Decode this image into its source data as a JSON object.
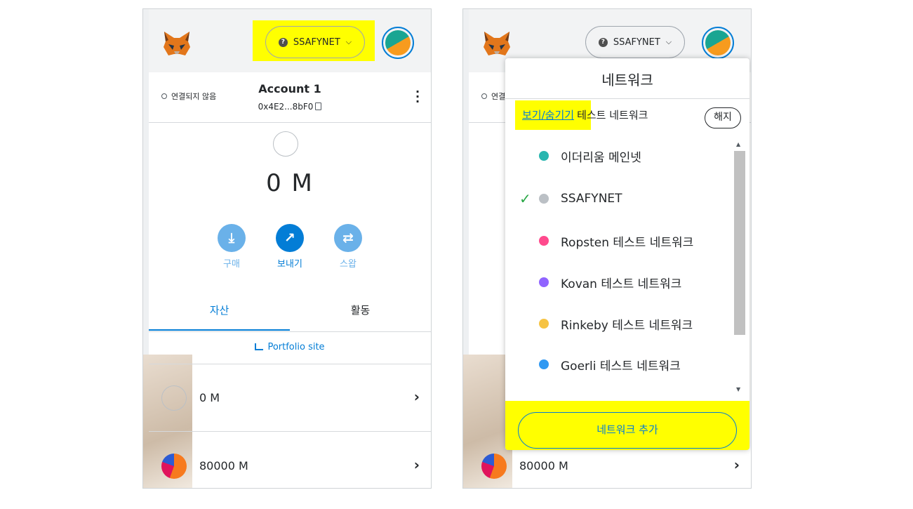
{
  "left": {
    "network_label": "SSAFYNET",
    "connection_status": "연결되지 않음",
    "account_name": "Account 1",
    "account_address": "0x4E2...8bF0",
    "balance": "0 M",
    "actions": [
      {
        "label": "구매",
        "icon": "download-icon",
        "color": "#6ab1e9"
      },
      {
        "label": "보내기",
        "icon": "arrow-up-right-icon",
        "color": "#037dd6"
      },
      {
        "label": "스왑",
        "icon": "swap-icon",
        "color": "#6ab1e9"
      }
    ],
    "tabs": [
      {
        "label": "자산",
        "active": true
      },
      {
        "label": "활동",
        "active": false
      }
    ],
    "portfolio_link": "Portfolio site",
    "assets": [
      {
        "value": "0 M",
        "icon": "empty-token-icon"
      },
      {
        "value": "80000 M",
        "icon": "pie-token-icon"
      }
    ]
  },
  "right": {
    "network_label": "SSAFYNET",
    "connection_status": "연결",
    "dropdown": {
      "title": "네트워크",
      "show_hide_link": "보기/숨기기",
      "show_hide_suffix": "테스트 네트워크",
      "hide_button": "해지",
      "networks": [
        {
          "name": "이더리움 메인넷",
          "color": "#29b6af",
          "selected": false
        },
        {
          "name": "SSAFYNET",
          "color": "#bbc0c5",
          "selected": true
        },
        {
          "name": "Ropsten 테스트 네트워크",
          "color": "#ff4a8d",
          "selected": false
        },
        {
          "name": "Kovan 테스트 네트워크",
          "color": "#9064ff",
          "selected": false
        },
        {
          "name": "Rinkeby 테스트 네트워크",
          "color": "#f6c343",
          "selected": false
        },
        {
          "name": "Goerli 테스트 네트워크",
          "color": "#3099f2",
          "selected": false
        }
      ],
      "add_network_button": "네트워크 추가"
    },
    "assets": [
      {
        "value": "80000 M",
        "icon": "pie-token-icon"
      }
    ]
  },
  "colors": {
    "highlight": "#ffff00",
    "accent": "#037dd6",
    "check": "#28a745"
  }
}
